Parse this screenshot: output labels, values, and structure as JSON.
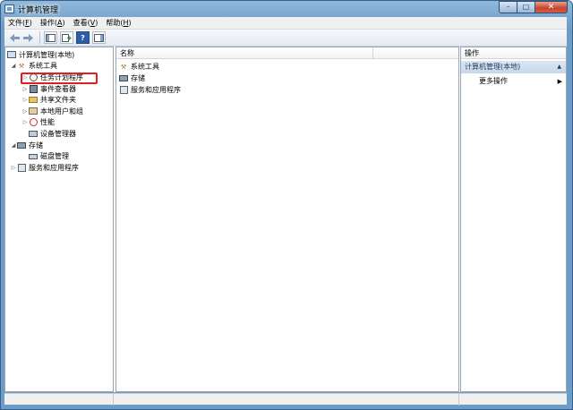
{
  "window": {
    "title": "计算机管理",
    "minimize_glyph": "–",
    "maximize_glyph": "□",
    "close_glyph": "✕"
  },
  "menu": [
    {
      "label": "文件(",
      "key": "F",
      "suffix": ")"
    },
    {
      "label": "操作(",
      "key": "A",
      "suffix": ")"
    },
    {
      "label": "查看(",
      "key": "V",
      "suffix": ")"
    },
    {
      "label": "帮助(",
      "key": "H",
      "suffix": ")"
    }
  ],
  "toolbar": {
    "back_icon": "back-arrow-icon",
    "forward_icon": "forward-arrow-icon",
    "help_glyph": "?"
  },
  "tree": {
    "root": "计算机管理(本地)",
    "system_tools": "系统工具",
    "task_scheduler": "任务计划程序",
    "event_viewer": "事件查看器",
    "shared_folders": "共享文件夹",
    "local_users": "本地用户和组",
    "performance": "性能",
    "device_manager": "设备管理器",
    "storage": "存储",
    "disk_management": "磁盘管理",
    "services_apps": "服务和应用程序"
  },
  "list": {
    "column_name": "名称",
    "items": [
      "系统工具",
      "存储",
      "服务和应用程序"
    ]
  },
  "actions": {
    "header": "操作",
    "section": "计算机管理(本地)",
    "more": "更多操作"
  },
  "colors": {
    "highlight_border": "#e02020",
    "title_gradient_top": "#8fb8dc",
    "actions_section_bg": "#c7d7ea"
  }
}
